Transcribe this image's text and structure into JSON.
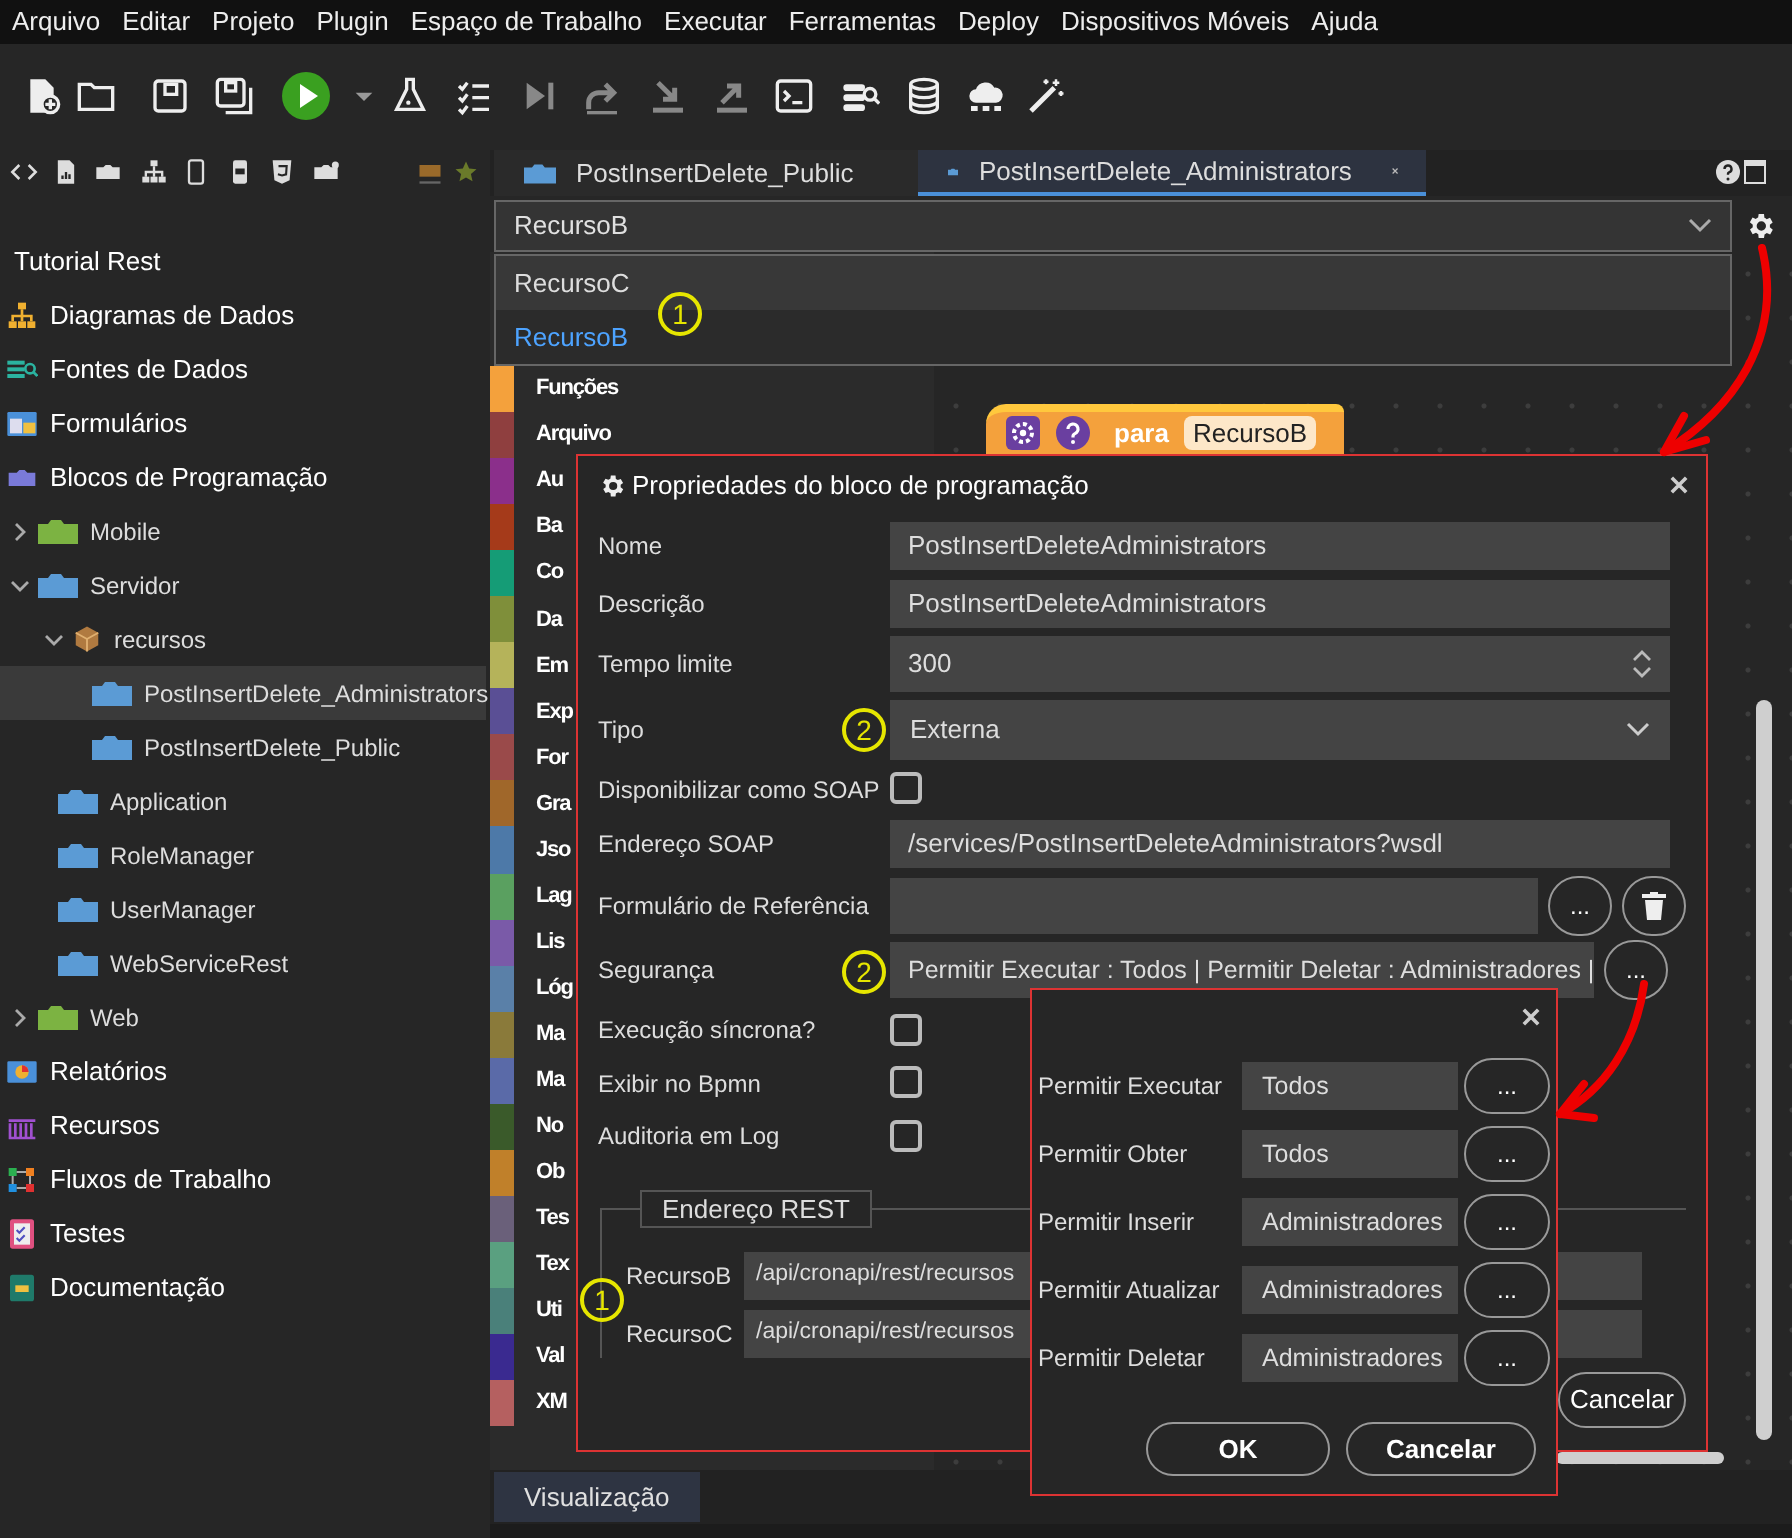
{
  "menu": [
    "Arquivo",
    "Editar",
    "Projeto",
    "Plugin",
    "Espaço de Trabalho",
    "Executar",
    "Ferramentas",
    "Deploy",
    "Dispositivos Móveis",
    "Ajuda"
  ],
  "sidebar": {
    "project": "Tutorial Rest",
    "tree": [
      {
        "kind": "section",
        "label": "Diagramas de Dados",
        "selected": false
      },
      {
        "kind": "section",
        "label": "Fontes de Dados",
        "selected": false
      },
      {
        "kind": "section",
        "label": "Formulários",
        "selected": false
      },
      {
        "kind": "section",
        "label": "Blocos de Programação",
        "selected": false,
        "children": [
          {
            "kind": "block",
            "label": "Mobile",
            "color": "#7cb342",
            "expanded": false,
            "selected": false
          },
          {
            "kind": "block",
            "label": "Servidor",
            "color": "#5b9bd5",
            "expanded": true,
            "selected": false,
            "children": [
              {
                "kind": "package",
                "label": "recursos",
                "expanded": true,
                "selected": false,
                "children": [
                  {
                    "kind": "block",
                    "label": "PostInsertDelete_Administrators",
                    "color": "#5b9bd5",
                    "selected": true
                  },
                  {
                    "kind": "block",
                    "label": "PostInsertDelete_Public",
                    "color": "#5b9bd5",
                    "selected": false
                  }
                ]
              },
              {
                "kind": "block",
                "label": "Application",
                "color": "#5b9bd5",
                "selected": false
              },
              {
                "kind": "block",
                "label": "RoleManager",
                "color": "#5b9bd5",
                "selected": false
              },
              {
                "kind": "block",
                "label": "UserManager",
                "color": "#5b9bd5",
                "selected": false
              },
              {
                "kind": "block",
                "label": "WebServiceRest",
                "color": "#5b9bd5",
                "selected": false
              }
            ]
          },
          {
            "kind": "block",
            "label": "Web",
            "color": "#7cb342",
            "expanded": false,
            "selected": false
          }
        ]
      },
      {
        "kind": "section",
        "label": "Relatórios",
        "selected": false
      },
      {
        "kind": "section",
        "label": "Recursos",
        "selected": false
      },
      {
        "kind": "section",
        "label": "Fluxos de Trabalho",
        "selected": false
      },
      {
        "kind": "section",
        "label": "Testes",
        "selected": false
      },
      {
        "kind": "section",
        "label": "Documentação",
        "selected": false
      }
    ]
  },
  "tabs": [
    {
      "label": "PostInsertDelete_Public",
      "selected": false
    },
    {
      "label": "PostInsertDelete_Administrators",
      "selected": true
    }
  ],
  "resource_select": {
    "value": "RecursoB",
    "options": [
      {
        "label": "RecursoC",
        "selected": false
      },
      {
        "label": "RecursoB",
        "selected": true
      }
    ]
  },
  "block_categories": [
    {
      "label": "Funções",
      "color": "#f4a13c"
    },
    {
      "label": "Arquivo",
      "color": "#8f3f3f"
    },
    {
      "label": "Au",
      "color": "#8b2f8b"
    },
    {
      "label": "Ba",
      "color": "#a53a1a"
    },
    {
      "label": "Co",
      "color": "#159c76"
    },
    {
      "label": "Da",
      "color": "#7f8f3a"
    },
    {
      "label": "Em",
      "color": "#b5b35a"
    },
    {
      "label": "Exp",
      "color": "#5a4f95"
    },
    {
      "label": "For",
      "color": "#9a4a4a"
    },
    {
      "label": "Gra",
      "color": "#a0672a"
    },
    {
      "label": "Jso",
      "color": "#4d79a8"
    },
    {
      "label": "Lag",
      "color": "#5aa060"
    },
    {
      "label": "Lis",
      "color": "#7a5aa8"
    },
    {
      "label": "Lóg",
      "color": "#5a80a8"
    },
    {
      "label": "Ma",
      "color": "#8a7a3a"
    },
    {
      "label": "Ma",
      "color": "#5a6aa8"
    },
    {
      "label": "No",
      "color": "#3a5a2a"
    },
    {
      "label": "Ob",
      "color": "#c0802a"
    },
    {
      "label": "Tes",
      "color": "#6a607a"
    },
    {
      "label": "Tex",
      "color": "#5aa080"
    },
    {
      "label": "Uti",
      "color": "#4a807a"
    },
    {
      "label": "Val",
      "color": "#3a2a90"
    },
    {
      "label": "XM",
      "color": "#b56060"
    }
  ],
  "canvas_block": {
    "keyword": "para",
    "name": "RecursoB"
  },
  "properties_dialog": {
    "title": "Propriedades do bloco de programação",
    "fields": [
      {
        "kind": "text",
        "label": "Nome",
        "value": "PostInsertDeleteAdministrators"
      },
      {
        "kind": "text",
        "label": "Descrição",
        "value": "PostInsertDeleteAdministrators"
      },
      {
        "kind": "number",
        "label": "Tempo limite",
        "value": "300"
      },
      {
        "kind": "select",
        "label": "Tipo",
        "value": "Externa"
      },
      {
        "kind": "checkbox",
        "label": "Disponibilizar como SOAP",
        "checked": false
      },
      {
        "kind": "text",
        "label": "Endereço SOAP",
        "value": "/services/PostInsertDeleteAdministrators?wsdl"
      },
      {
        "kind": "picker_clear",
        "label": "Formulário de Referência",
        "button": "..."
      },
      {
        "kind": "picker",
        "label": "Segurança",
        "value": "Permitir Executar : Todos | Permitir Deletar : Administradores |",
        "button": "..."
      },
      {
        "kind": "checkbox",
        "label": "Execução síncrona?",
        "checked": false
      },
      {
        "kind": "checkbox",
        "label": "Exibir no Bpmn",
        "checked": false
      },
      {
        "kind": "checkbox",
        "label": "Auditoria em Log",
        "checked": false
      }
    ],
    "rest_section": {
      "legend": "Endereço REST",
      "rows": [
        {
          "label": "RecursoB",
          "value": "/api/cronapi/rest/recursos"
        },
        {
          "label": "RecursoC",
          "value": "/api/cronapi/rest/recursos"
        }
      ]
    },
    "cancel_button": "Cancelar"
  },
  "security_dialog": {
    "rows": [
      {
        "label": "Permitir Executar",
        "value": "Todos",
        "button": "..."
      },
      {
        "label": "Permitir Obter",
        "value": "Todos",
        "button": "..."
      },
      {
        "label": "Permitir Inserir",
        "value": "Administradores",
        "button": "..."
      },
      {
        "label": "Permitir Atualizar",
        "value": "Administradores",
        "button": "..."
      },
      {
        "label": "Permitir Deletar",
        "value": "Administradores",
        "button": "..."
      }
    ],
    "ok_button": "OK",
    "cancel_button": "Cancelar"
  },
  "bottom_tab": "Visualização",
  "annotations": [
    {
      "label": "1"
    },
    {
      "label": "2"
    },
    {
      "label": "2"
    },
    {
      "label": "1"
    }
  ]
}
